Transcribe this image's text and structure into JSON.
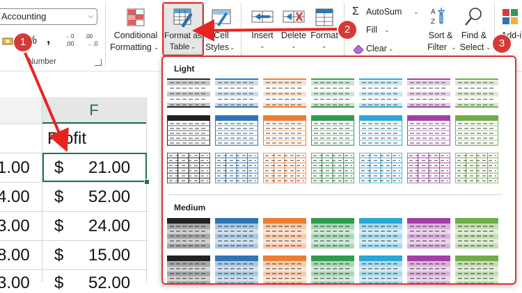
{
  "ribbon": {
    "number_format": {
      "value": "Accounting"
    },
    "number_group_label": "Number",
    "conditional_formatting": {
      "line1": "Conditional",
      "line2": "Formatting"
    },
    "format_as_table": {
      "line1": "Format as",
      "line2": "Table"
    },
    "cell_styles": {
      "line1": "Cell",
      "line2": "Styles"
    },
    "insert_label": "Insert",
    "delete_label": "Delete",
    "format_label": "Format",
    "autosum_label": "AutoSum",
    "fill_label": "Fill",
    "clear_label": "Clear",
    "sort_filter": {
      "line1": "Sort &",
      "line2": "Filter"
    },
    "find_select": {
      "line1": "Find &",
      "line2": "Select"
    },
    "addins": {
      "line1": "Add-i",
      "line2": "d-i"
    }
  },
  "table_styles_gallery": {
    "sections": [
      {
        "title": "Light"
      },
      {
        "title": "Medium"
      }
    ],
    "colors": [
      "#222222",
      "#2e75b6",
      "#ed7d31",
      "#2e9b4e",
      "#2ba6d6",
      "#a43ea7",
      "#70ad47"
    ]
  },
  "sheet": {
    "column_header": "F",
    "partial_values": [
      "1.00",
      "4.00",
      "3.00",
      "8.00",
      "3.00"
    ],
    "header_cell": "Profit",
    "currency_symbol": "$",
    "profits": [
      "21.00",
      "52.00",
      "24.00",
      "15.00",
      "52.00"
    ]
  },
  "annotations": {
    "badges": [
      "1",
      "2",
      "3"
    ],
    "badge_color": "#d63a36"
  }
}
